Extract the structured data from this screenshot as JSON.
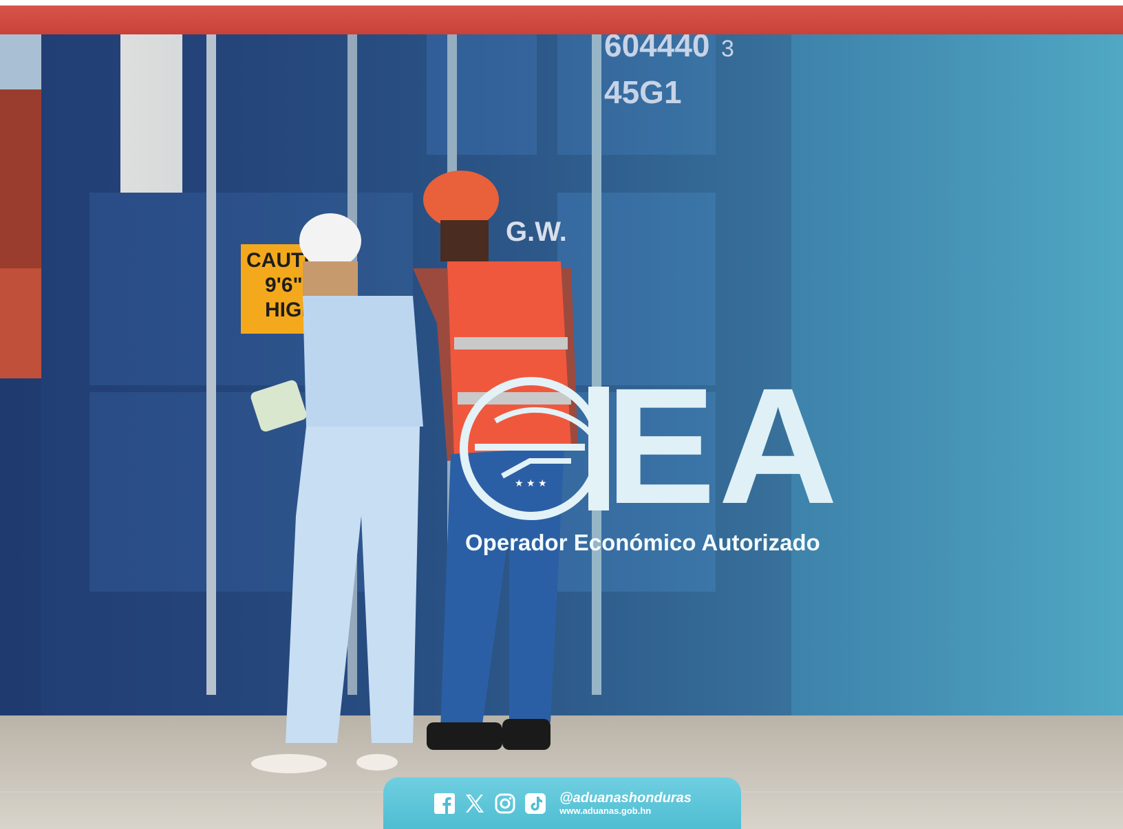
{
  "colors": {
    "top_bar": "#c8423a",
    "footer_tab": "#4fbdd2",
    "logo_text": "#dff1f6"
  },
  "photo": {
    "container_codes": [
      "604440",
      "3",
      "45G1"
    ],
    "gw_mark": "G.W.",
    "caution_label": [
      "CAUTIC",
      "9'6\"",
      "HIGH"
    ]
  },
  "logo": {
    "letters": "EA",
    "subtitle": "Operador Económico Autorizado",
    "emblem": "oea-emblem-icon"
  },
  "footer": {
    "icons": [
      "facebook-icon",
      "x-icon",
      "instagram-icon",
      "tiktok-icon"
    ],
    "handle": "@aduanashonduras",
    "website": "www.aduanas.gob.hn"
  }
}
